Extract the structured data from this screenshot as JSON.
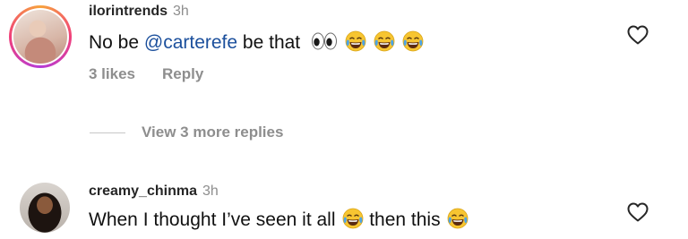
{
  "comments": [
    {
      "username": "ilorintrends",
      "time": "3h",
      "text_before": "No be ",
      "mention": "@carterefe",
      "text_after": " be that",
      "emojis": [
        "eyes-emoji",
        "tears-of-joy-emoji",
        "tears-of-joy-emoji",
        "tears-of-joy-emoji"
      ],
      "likes": "3 likes",
      "reply_label": "Reply",
      "view_replies": "View 3 more replies"
    },
    {
      "username": "creamy_chinma",
      "time": "3h",
      "text_before": "When I thought I’ve seen it all",
      "text_after": "then this"
    }
  ],
  "icons": {
    "like": "heart-outline-icon"
  },
  "colors": {
    "mention": "#1b4f9c",
    "muted": "#8e8e8e",
    "story_ring": "#f03f7a"
  }
}
